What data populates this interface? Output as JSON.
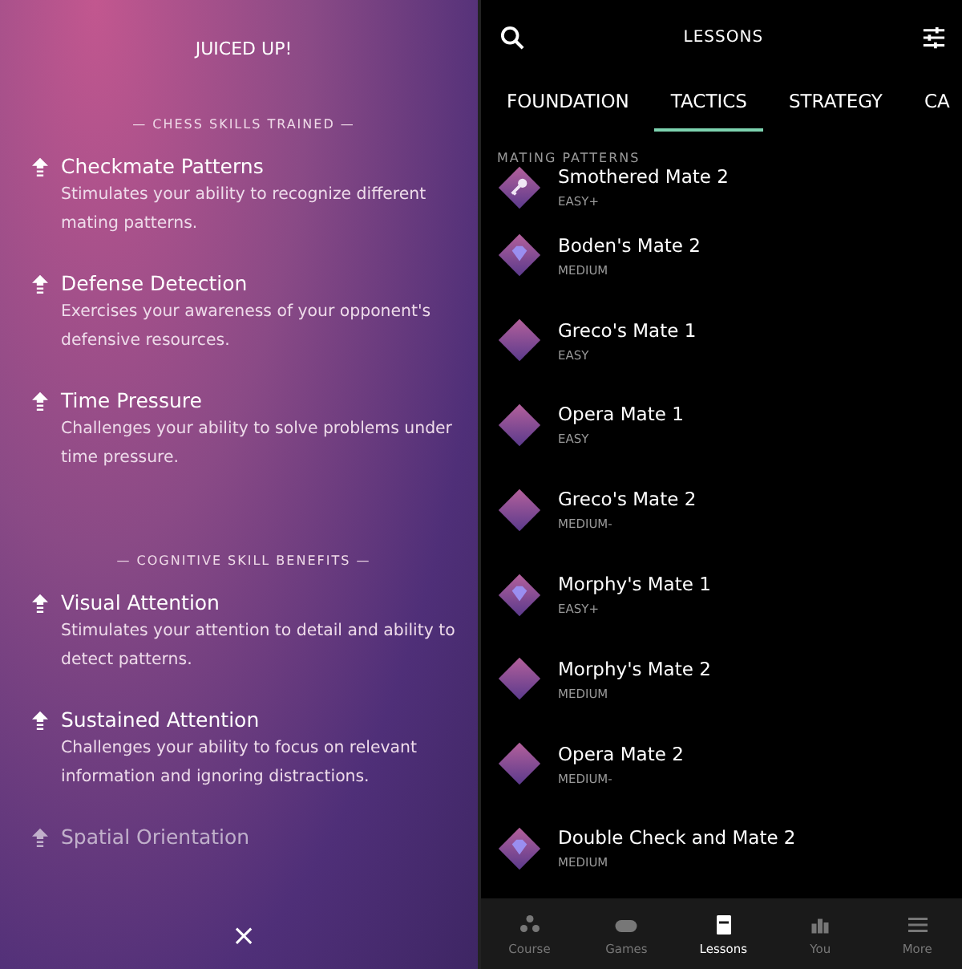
{
  "summary": {
    "title": "JUICED UP!",
    "sections": [
      {
        "heading": "— CHESS SKILLS TRAINED —",
        "skills": [
          {
            "name": "Checkmate Patterns",
            "description": "Stimulates your ability to recognize different mating patterns.",
            "faded": false
          },
          {
            "name": "Defense Detection",
            "description": "Exercises your awareness of your opponent's defensive resources.",
            "faded": false
          },
          {
            "name": "Time Pressure",
            "description": "Challenges your ability to solve problems under time pressure.",
            "faded": false
          }
        ]
      },
      {
        "heading": "— COGNITIVE SKILL BENEFITS —",
        "skills": [
          {
            "name": "Visual Attention",
            "description": "Stimulates your attention to detail and ability to detect patterns.",
            "faded": false
          },
          {
            "name": "Sustained Attention",
            "description": "Challenges your ability to focus on relevant information and ignoring distractions.",
            "faded": false
          },
          {
            "name": "Spatial Orientation",
            "faded": true
          }
        ]
      }
    ],
    "close": "×"
  },
  "lessons": {
    "title": "LESSONS",
    "tabs": [
      {
        "label": "FOUNDATION",
        "selected": false
      },
      {
        "label": "TACTICS",
        "selected": true
      },
      {
        "label": "STRATEGY",
        "selected": false
      },
      {
        "label": "CA",
        "selected": false
      }
    ],
    "section": "MATING PATTERNS",
    "items": [
      {
        "name": "Smothered Mate 2",
        "difficulty": "EASY+",
        "kind": "key"
      },
      {
        "name": "Boden's Mate 2",
        "difficulty": "MEDIUM",
        "kind": "gem"
      },
      {
        "name": "Greco's Mate 1",
        "difficulty": "EASY",
        "kind": "plain"
      },
      {
        "name": "Opera Mate 1",
        "difficulty": "EASY",
        "kind": "plain"
      },
      {
        "name": "Greco's Mate 2",
        "difficulty": "MEDIUM-",
        "kind": "plain"
      },
      {
        "name": "Morphy's Mate 1",
        "difficulty": "EASY+",
        "kind": "gem"
      },
      {
        "name": "Morphy's Mate 2",
        "difficulty": "MEDIUM",
        "kind": "plain"
      },
      {
        "name": "Opera Mate 2",
        "difficulty": "MEDIUM-",
        "kind": "plain"
      },
      {
        "name": "Double Check and Mate 2",
        "difficulty": "MEDIUM",
        "kind": "gem"
      }
    ],
    "nav": [
      {
        "label": "Course",
        "kind": "course",
        "selected": false
      },
      {
        "label": "Games",
        "kind": "games",
        "selected": false
      },
      {
        "label": "Lessons",
        "kind": "lessons",
        "selected": true
      },
      {
        "label": "You",
        "kind": "you",
        "selected": false
      },
      {
        "label": "More",
        "kind": "more",
        "selected": false
      }
    ]
  }
}
